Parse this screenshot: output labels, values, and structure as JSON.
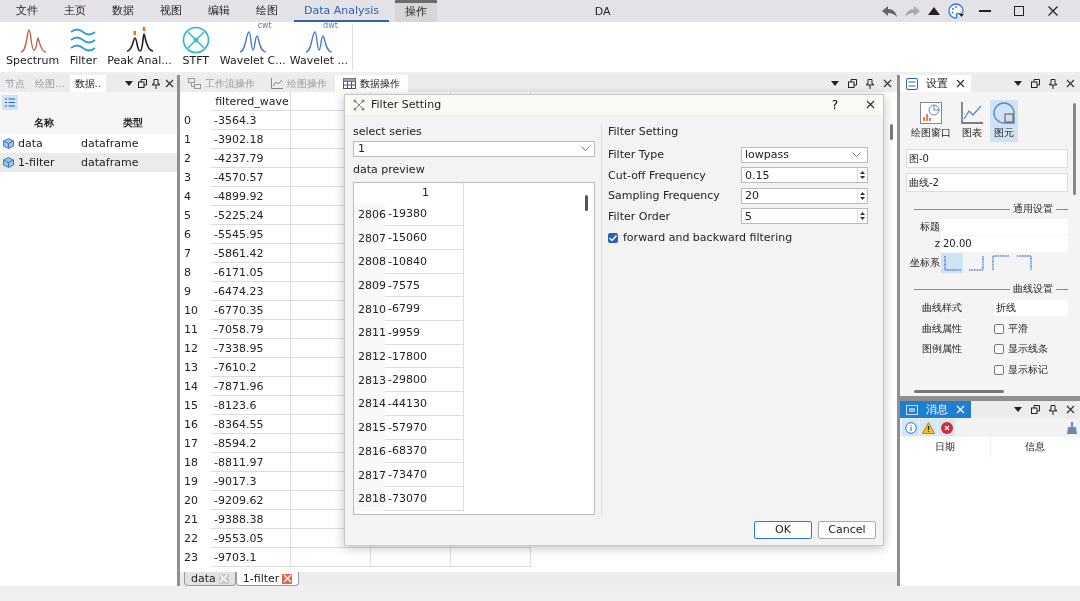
{
  "menu": [
    {
      "label": "文件",
      "selected": false,
      "highlighted": false
    },
    {
      "label": "主页",
      "selected": false,
      "highlighted": false
    },
    {
      "label": "数据",
      "selected": false,
      "highlighted": false
    },
    {
      "label": "视图",
      "selected": false,
      "highlighted": false
    },
    {
      "label": "编辑",
      "selected": false,
      "highlighted": false
    },
    {
      "label": "绘图",
      "selected": false,
      "highlighted": false
    },
    {
      "label": "Data Analysis",
      "selected": true,
      "highlighted": false
    },
    {
      "label": "操作",
      "selected": false,
      "highlighted": true
    }
  ],
  "title": "DA",
  "ribbon": [
    {
      "label": "Spectrum",
      "kind": "spectrum"
    },
    {
      "label": "Filter",
      "kind": "filter"
    },
    {
      "label": "Peak Anal...",
      "kind": "peak"
    },
    {
      "label": "STFT",
      "kind": "stft"
    },
    {
      "label": "Wavelet C...",
      "kind": "wavelet",
      "tag": "cwt"
    },
    {
      "label": "Wavelet ...",
      "kind": "wavelet",
      "tag": "dwt"
    }
  ],
  "left_panel": {
    "tabs": [
      {
        "label": "节点",
        "selected": false
      },
      {
        "label": "绘图...",
        "selected": false
      },
      {
        "label": "数据..",
        "selected": true
      }
    ],
    "columns": [
      "名称",
      "类型"
    ],
    "rows": [
      {
        "name": "data",
        "type": "dataframe",
        "selected": false
      },
      {
        "name": "1-filter",
        "type": "dataframe",
        "selected": true
      }
    ]
  },
  "center_panel": {
    "tabs": [
      {
        "label": "工作流操作",
        "selected": false,
        "kind": "workflow"
      },
      {
        "label": "绘图操作",
        "selected": false,
        "kind": "chart"
      },
      {
        "label": "数据操作",
        "selected": true,
        "kind": "table"
      }
    ],
    "column": "filtered_wave",
    "rows": [
      {
        "index": "0",
        "value": "-3564.3"
      },
      {
        "index": "1",
        "value": "-3902.18"
      },
      {
        "index": "2",
        "value": "-4237.79"
      },
      {
        "index": "3",
        "value": "-4570.57"
      },
      {
        "index": "4",
        "value": "-4899.92"
      },
      {
        "index": "5",
        "value": "-5225.24"
      },
      {
        "index": "6",
        "value": "-5545.95"
      },
      {
        "index": "7",
        "value": "-5861.42"
      },
      {
        "index": "8",
        "value": "-6171.05"
      },
      {
        "index": "9",
        "value": "-6474.23"
      },
      {
        "index": "10",
        "value": "-6770.35"
      },
      {
        "index": "11",
        "value": "-7058.79"
      },
      {
        "index": "12",
        "value": "-7338.95"
      },
      {
        "index": "13",
        "value": "-7610.2"
      },
      {
        "index": "14",
        "value": "-7871.96"
      },
      {
        "index": "15",
        "value": "-8123.6"
      },
      {
        "index": "16",
        "value": "-8364.55"
      },
      {
        "index": "17",
        "value": "-8594.2"
      },
      {
        "index": "18",
        "value": "-8811.97"
      },
      {
        "index": "19",
        "value": "-9017.3"
      },
      {
        "index": "20",
        "value": "-9209.62"
      },
      {
        "index": "21",
        "value": "-9388.38"
      },
      {
        "index": "22",
        "value": "-9553.05"
      },
      {
        "index": "23",
        "value": "-9703.1"
      }
    ],
    "sheets": [
      {
        "label": "data",
        "selected": false
      },
      {
        "label": "1-filter",
        "selected": true
      }
    ]
  },
  "dialog": {
    "title": "Filter Setting",
    "help": "?",
    "series_label": "select series",
    "series": "1",
    "preview_label": "data preview",
    "preview_column": "1",
    "preview_rows": [
      {
        "index": "2806",
        "value": "-19380"
      },
      {
        "index": "2807",
        "value": "-15060"
      },
      {
        "index": "2808",
        "value": "-10840"
      },
      {
        "index": "2809",
        "value": "-7575"
      },
      {
        "index": "2810",
        "value": "-6799"
      },
      {
        "index": "2811",
        "value": "-9959"
      },
      {
        "index": "2812",
        "value": "-17800"
      },
      {
        "index": "2813",
        "value": "-29800"
      },
      {
        "index": "2814",
        "value": "-44130"
      },
      {
        "index": "2815",
        "value": "-57970"
      },
      {
        "index": "2816",
        "value": "-68370"
      },
      {
        "index": "2817",
        "value": "-73470"
      },
      {
        "index": "2818",
        "value": "-73070"
      }
    ],
    "group_title": "Filter Setting",
    "params": [
      {
        "label": "Filter Type",
        "value": "lowpass",
        "kind": "combo"
      },
      {
        "label": "Cut-off Frequency",
        "value": "0.15",
        "kind": "spin"
      },
      {
        "label": "Sampling Frequency",
        "value": "20",
        "kind": "spin"
      },
      {
        "label": "Filter Order",
        "value": "5",
        "kind": "spin"
      }
    ],
    "option": {
      "label": "forward and backward filtering",
      "checked": true
    },
    "buttons": [
      {
        "label": "OK",
        "default": true
      },
      {
        "label": "Cancel",
        "default": false
      }
    ]
  },
  "settings_panel": {
    "tab": "设置",
    "modes": [
      {
        "label": "绘图窗口",
        "selected": false,
        "kind": "window"
      },
      {
        "label": "图表",
        "selected": false,
        "kind": "chart"
      },
      {
        "label": "图元",
        "selected": true,
        "kind": "element"
      }
    ],
    "fields": [
      "图-0",
      "曲线-2"
    ],
    "general": {
      "title": "通用设置",
      "title_label": "标题",
      "z_label": "z",
      "z_value": "20.00",
      "axes_label": "坐标系",
      "axes": [
        {
          "kind": "bottom-left",
          "selected": true
        },
        {
          "kind": "bottom-right",
          "selected": false
        },
        {
          "kind": "top-left",
          "selected": false
        },
        {
          "kind": "top-right",
          "selected": false
        }
      ]
    },
    "curve": {
      "title": "曲线设置",
      "style_label": "曲线样式",
      "style_value": "折线",
      "rows": [
        {
          "label": "曲线属性",
          "option": "平滑",
          "checked": false
        },
        {
          "label": "图例属性",
          "option": "显示线条",
          "checked": false
        },
        {
          "option": "显示标记",
          "checked": false
        }
      ]
    }
  },
  "messages_panel": {
    "tab": "消息",
    "columns": [
      "日期",
      "信息"
    ]
  }
}
